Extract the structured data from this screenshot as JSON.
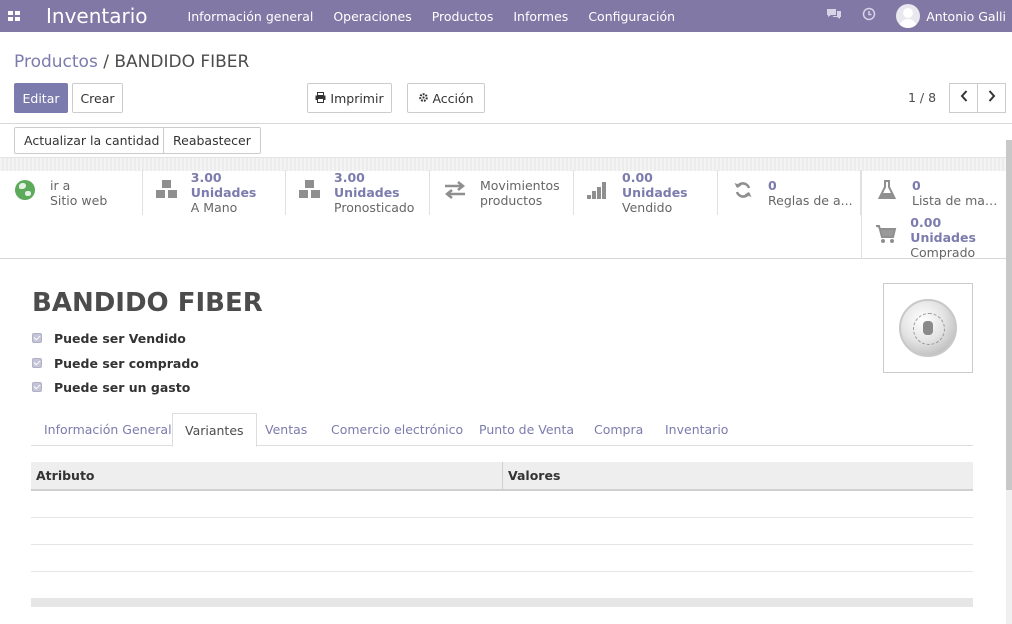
{
  "navbar": {
    "app_title": "Inventario",
    "menu": [
      {
        "label": "Información general"
      },
      {
        "label": "Operaciones"
      },
      {
        "label": "Productos"
      },
      {
        "label": "Informes"
      },
      {
        "label": "Configuración"
      }
    ],
    "user_name": "Antonio Galli",
    "icons": {
      "apps": "grid-icon",
      "chat": "chat-icon",
      "activity": "clock-icon",
      "avatar": "user-avatar"
    }
  },
  "control_panel": {
    "breadcrumb": {
      "parent": "Productos",
      "separator": "/",
      "current": "BANDIDO FIBER"
    },
    "buttons": {
      "edit": "Editar",
      "create": "Crear",
      "print": "Imprimir",
      "action": "Acción"
    },
    "pager": {
      "value": "1 / 8"
    }
  },
  "status_bar": {
    "buttons": [
      "Actualizar la cantidad",
      "Reabastecer"
    ]
  },
  "stat_buttons": [
    {
      "name": "website",
      "icon": "globe-icon",
      "line1": "ir a",
      "line2": "Sitio web",
      "bold": false
    },
    {
      "name": "on-hand",
      "icon": "cubes-icon",
      "line1": "3.00 Unidades",
      "line2": "A Mano",
      "bold": true
    },
    {
      "name": "forecasted",
      "icon": "cubes-icon",
      "line1": "3.00 Unidades",
      "line2": "Pronosticado",
      "bold": true
    },
    {
      "name": "moves",
      "icon": "exchange-icon",
      "line1": "Movimientos",
      "line2": "productos",
      "bold": false
    },
    {
      "name": "sold",
      "icon": "signal-icon",
      "line1": "0.00 Unidades",
      "line2": "Vendido",
      "bold": true
    },
    {
      "name": "reorder-rules",
      "icon": "refresh-icon",
      "line1": "0",
      "line2": "Reglas de a...",
      "bold": true
    },
    {
      "name": "bom",
      "icon": "flask-icon",
      "line1": "0",
      "line2": "Lista de mat...",
      "bold": true
    },
    {
      "name": "purchased",
      "icon": "cart-icon",
      "line1": "0.00 Unidades",
      "line2": "Comprado",
      "bold": true
    }
  ],
  "product": {
    "name": "BANDIDO FIBER",
    "checks": [
      {
        "label": "Puede ser Vendido",
        "checked": true
      },
      {
        "label": "Puede ser comprado",
        "checked": true
      },
      {
        "label": "Puede ser un gasto",
        "checked": true
      }
    ]
  },
  "tabs": [
    {
      "label": "Información General",
      "active": false
    },
    {
      "label": "Variantes",
      "active": true
    },
    {
      "label": "Ventas",
      "active": false
    },
    {
      "label": "Comercio electrónico",
      "active": false
    },
    {
      "label": "Punto de Venta",
      "active": false
    },
    {
      "label": "Compra",
      "active": false
    },
    {
      "label": "Inventario",
      "active": false
    }
  ],
  "variants_table": {
    "headers": [
      "Atributo",
      "Valores"
    ],
    "rows": []
  },
  "colors": {
    "navbar": "#8178a6",
    "primary": "#7c7bad",
    "link": "#7c7bad"
  }
}
